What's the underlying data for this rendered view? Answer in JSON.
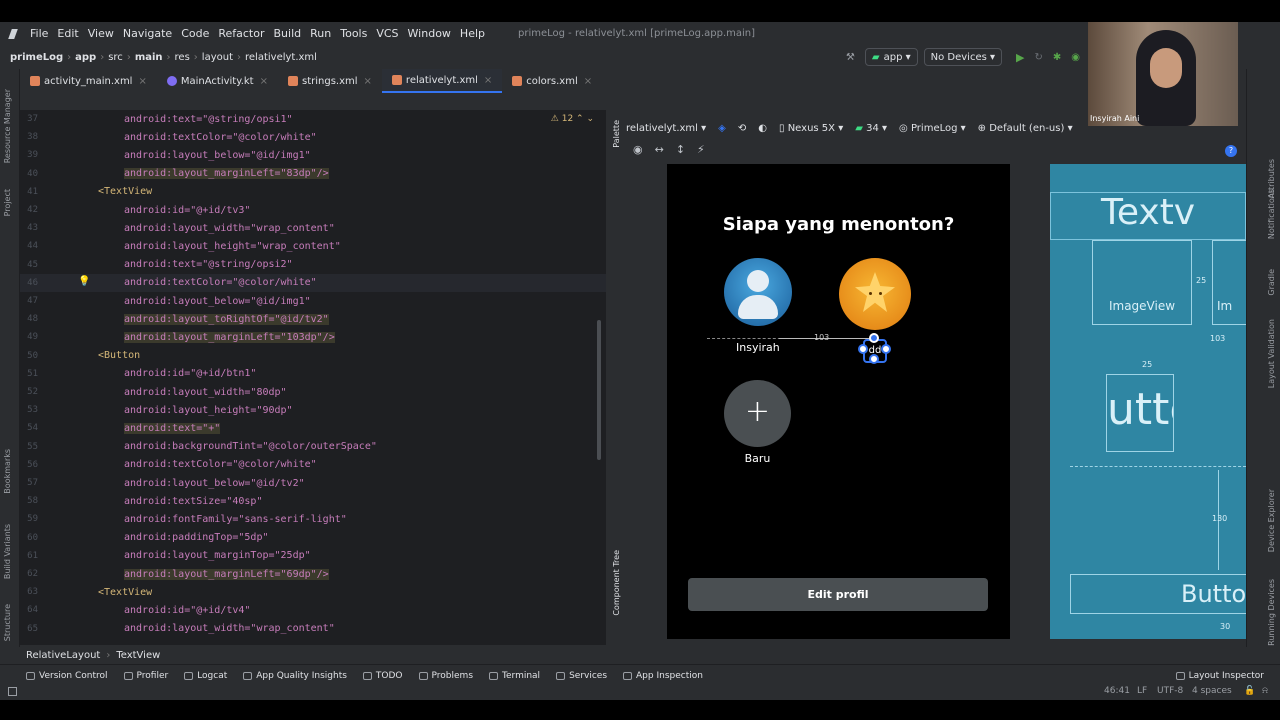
{
  "menu": {
    "items": [
      "File",
      "Edit",
      "View",
      "Navigate",
      "Code",
      "Refactor",
      "Build",
      "Run",
      "Tools",
      "VCS",
      "Window",
      "Help"
    ],
    "window_title": "primeLog - relativelyt.xml [primeLog.app.main]"
  },
  "breadcrumb": {
    "items": [
      "primeLog",
      "app",
      "src",
      "main",
      "res",
      "layout",
      "relativelyt.xml"
    ]
  },
  "toolbar": {
    "run_config": "app",
    "device": "No Devices"
  },
  "tabs": [
    {
      "label": "activity_main.xml",
      "active": false
    },
    {
      "label": "MainActivity.kt",
      "active": false
    },
    {
      "label": "strings.xml",
      "active": false
    },
    {
      "label": "relativelyt.xml",
      "active": true
    },
    {
      "label": "colors.xml",
      "active": false
    }
  ],
  "left_tools": [
    "Resource Manager",
    "Project",
    "Bookmarks",
    "Build Variants",
    "Structure"
  ],
  "right_tools": [
    "Gradle",
    "Layout Validation",
    "Device Explorer",
    "Running Devices",
    "Notifications",
    "Attributes"
  ],
  "editor": {
    "warning_count": "12",
    "lines": [
      {
        "n": "37",
        "code": "android:text=\"@string/opsi1\""
      },
      {
        "n": "38",
        "code": "android:textColor=\"@color/white\""
      },
      {
        "n": "39",
        "code": "android:layout_below=\"@id/img1\""
      },
      {
        "n": "40",
        "code": "android:layout_marginLeft=\"83dp\"/>"
      },
      {
        "n": "41",
        "code": "<TextView"
      },
      {
        "n": "42",
        "code": "android:id=\"@+id/tv3\""
      },
      {
        "n": "43",
        "code": "android:layout_width=\"wrap_content\""
      },
      {
        "n": "44",
        "code": "android:layout_height=\"wrap_content\""
      },
      {
        "n": "45",
        "code": "android:text=\"@string/opsi2\""
      },
      {
        "n": "46",
        "code": "android:textColor=\"@color/white\""
      },
      {
        "n": "47",
        "code": "android:layout_below=\"@id/img1\""
      },
      {
        "n": "48",
        "code": "android:layout_toRightOf=\"@id/tv2\""
      },
      {
        "n": "49",
        "code": "android:layout_marginLeft=\"103dp\"/>"
      },
      {
        "n": "50",
        "code": "<Button"
      },
      {
        "n": "51",
        "code": "android:id=\"@+id/btn1\""
      },
      {
        "n": "52",
        "code": "android:layout_width=\"80dp\""
      },
      {
        "n": "53",
        "code": "android:layout_height=\"90dp\""
      },
      {
        "n": "54",
        "code": "android:text=\"+\""
      },
      {
        "n": "55",
        "code": "android:backgroundTint=\"@color/outerSpace\""
      },
      {
        "n": "56",
        "code": "android:textColor=\"@color/white\""
      },
      {
        "n": "57",
        "code": "android:layout_below=\"@id/tv2\""
      },
      {
        "n": "58",
        "code": "android:textSize=\"40sp\""
      },
      {
        "n": "59",
        "code": "android:fontFamily=\"sans-serif-light\""
      },
      {
        "n": "60",
        "code": "android:paddingTop=\"5dp\""
      },
      {
        "n": "61",
        "code": "android:layout_marginTop=\"25dp\""
      },
      {
        "n": "62",
        "code": "android:layout_marginLeft=\"69dp\"/>"
      },
      {
        "n": "63",
        "code": "<TextView"
      },
      {
        "n": "64",
        "code": "android:id=\"@+id/tv4\""
      },
      {
        "n": "65",
        "code": "android:layout_width=\"wrap_content\""
      }
    ]
  },
  "design": {
    "file": "relativelyt.xml",
    "device": "Nexus 5X",
    "api": "34",
    "theme": "PrimeLog",
    "locale": "Default (en-us)",
    "palette_label": "Palette",
    "component_tree_label": "Component Tree"
  },
  "phone": {
    "title": "Siapa yang menonton?",
    "profile1": "Insyirah",
    "profile2": "dd",
    "add_symbol": "+",
    "add_label": "Baru",
    "dimension": "103",
    "edit_button": "Edit profil"
  },
  "blueprint": {
    "textview": "Textv",
    "imageview": "ImageView",
    "imageview2": "Im",
    "button_big": "utto",
    "button": "Butto",
    "dim_25a": "25",
    "dim_25b": "25",
    "dim_103": "103",
    "dim_130": "130",
    "dim_30": "30"
  },
  "webcam": {
    "name": "Insyirah Aini"
  },
  "breadcrumb_bottom": [
    "RelativeLayout",
    "TextView"
  ],
  "tool_windows": [
    "Version Control",
    "Profiler",
    "Logcat",
    "App Quality Insights",
    "TODO",
    "Problems",
    "Terminal",
    "Services",
    "App Inspection"
  ],
  "layout_inspector": "Layout Inspector",
  "status": {
    "position": "46:41",
    "line_sep": "LF",
    "encoding": "UTF-8",
    "indent": "4 spaces"
  },
  "colors": {
    "accent": "#3574f0",
    "blueprint": "#2f86a3",
    "phone_bg": "#000000",
    "button": "#4a4f52"
  }
}
